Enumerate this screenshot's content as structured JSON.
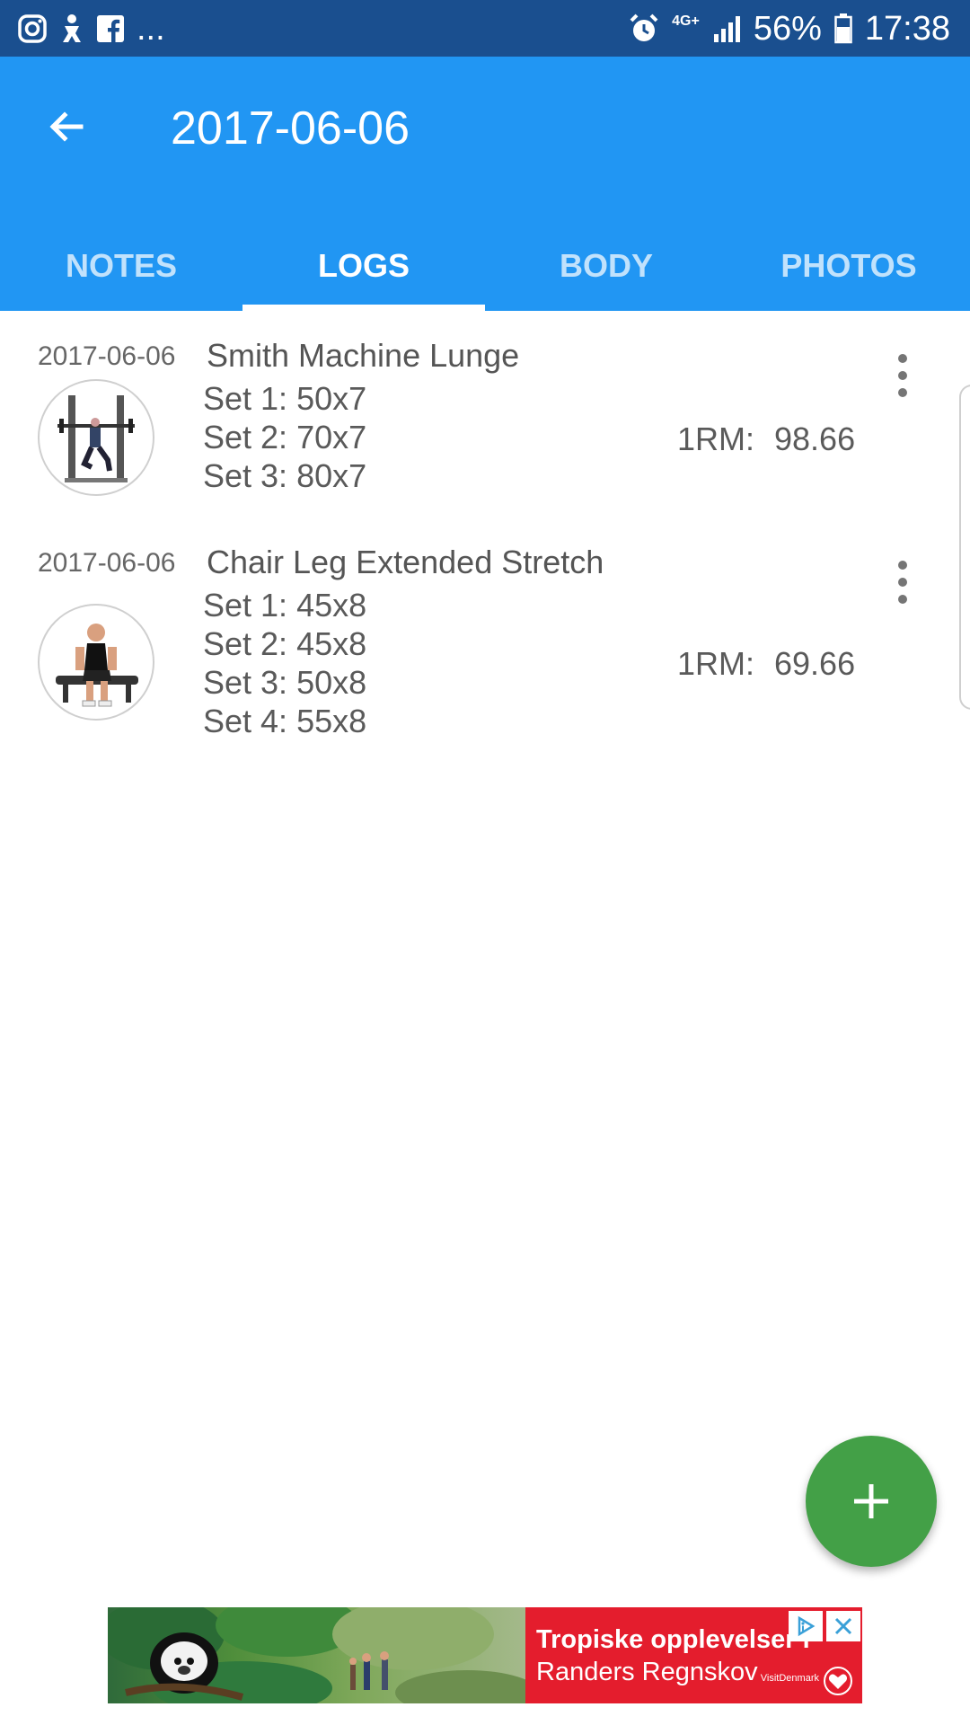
{
  "status_bar": {
    "left_icons": [
      "instagram-icon",
      "notification-icon",
      "facebook-icon"
    ],
    "ellipsis": "...",
    "network": "4G+",
    "battery": "56%",
    "time": "17:38"
  },
  "appbar": {
    "title": "2017-06-06"
  },
  "tabs": [
    {
      "label": "NOTES"
    },
    {
      "label": "LOGS",
      "active": true
    },
    {
      "label": "BODY"
    },
    {
      "label": "PHOTOS"
    }
  ],
  "logs": [
    {
      "date": "2017-06-06",
      "exercise": "Smith Machine Lunge",
      "sets": [
        "Set 1: 50x7",
        "Set 2: 70x7",
        "Set 3: 80x7"
      ],
      "rm_label": "1RM:",
      "rm_value": "98.66"
    },
    {
      "date": "2017-06-06",
      "exercise": "Chair Leg Extended Stretch",
      "sets": [
        "Set 1: 45x8",
        "Set 2: 45x8",
        "Set 3: 50x8",
        "Set 4: 55x8"
      ],
      "rm_label": "1RM:",
      "rm_value": "69.66"
    }
  ],
  "fab": {
    "icon": "plus-icon"
  },
  "ad": {
    "line1": "Tropiske opplevelser i",
    "line2": "Randers Regnskov",
    "brand": "VisitDenmark"
  },
  "colors": {
    "status_bar": "#1a4f8f",
    "primary": "#2196f3",
    "fab": "#43a047",
    "ad_red": "#e41d2d"
  }
}
